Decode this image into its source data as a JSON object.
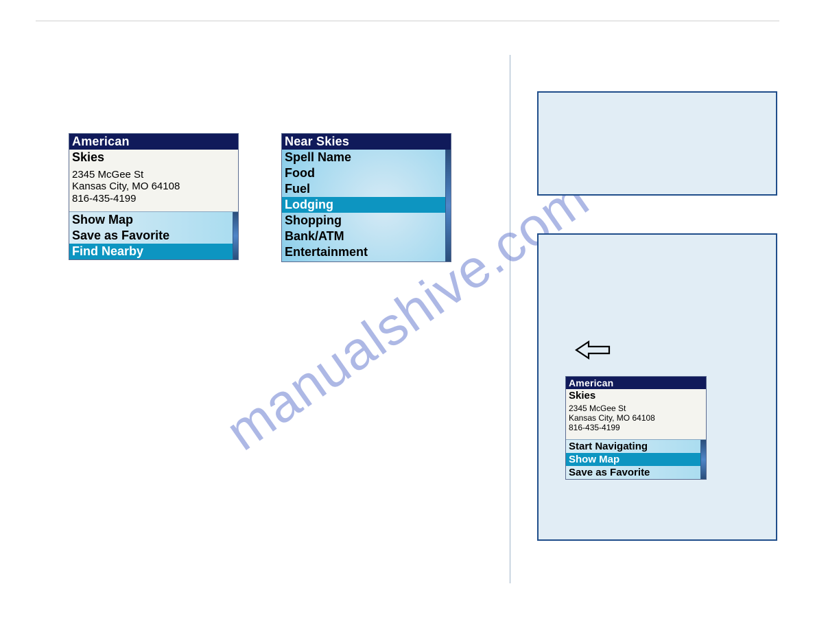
{
  "watermark_text": "manualshive.com",
  "device1": {
    "title": "American",
    "name": "Skies",
    "addr1": "2345 McGee St",
    "addr2": "Kansas City, MO 64108",
    "phone": "816-435-4199",
    "menu": [
      "Show Map",
      "Save as Favorite",
      "Find Nearby"
    ],
    "selected_index": 2
  },
  "device2": {
    "title": "Near Skies",
    "categories": [
      "Spell Name",
      "Food",
      "Fuel",
      "Lodging",
      "Shopping",
      "Bank/ATM",
      "Entertainment"
    ],
    "selected_index": 3
  },
  "device3": {
    "title": "American",
    "name": "Skies",
    "addr1": "2345 McGee St",
    "addr2": "Kansas City, MO 64108",
    "phone": "816-435-4199",
    "menu": [
      "Start Navigating",
      "Show Map",
      "Save as Favorite"
    ],
    "selected_index": 1
  }
}
